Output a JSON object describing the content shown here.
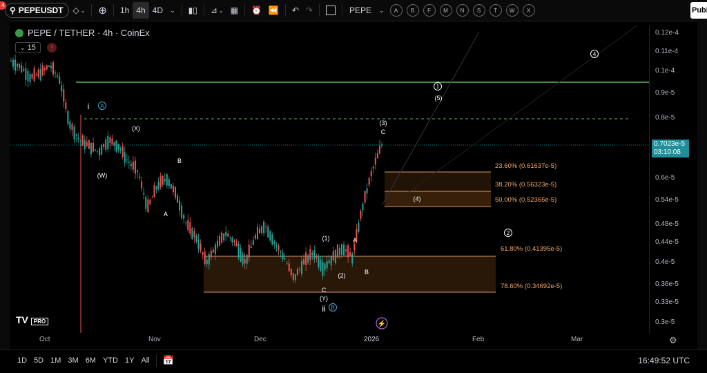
{
  "toolbar": {
    "symbol": "PEPEUSDT",
    "intervals": [
      "1h",
      "4h",
      "4D"
    ],
    "active_interval": "4h",
    "tool_label": "PEPE",
    "pattern_letters": [
      "A",
      "B",
      "F",
      "M",
      "N",
      "S",
      "T",
      "W",
      "X"
    ],
    "publish_label": "Publi",
    "notification_count": "4"
  },
  "legend": {
    "title": "PEPE / TETHER · 4h · CoinEx",
    "interval_count": "15",
    "warning": "!"
  },
  "price_axis": {
    "labels": [
      "0.12e-4",
      "0.11e-4",
      "0.1e-4",
      "0.9e-5",
      "0.8e-5",
      "0.7023e-5",
      "0.6e-5",
      "0.54e-5",
      "0.48e-5",
      "0.44e-5",
      "0.4e-5",
      "0.36e-5",
      "0.33e-5",
      "0.3e-5"
    ],
    "last_price": "0.7023e-5",
    "countdown": "03:10:08"
  },
  "time_axis": {
    "labels": [
      "Oct",
      "Nov",
      "Dec",
      "2026",
      "Feb",
      "Mar"
    ]
  },
  "fib_levels": [
    {
      "label": "23.60% (0.61637e-5)",
      "color": "#f0a46a"
    },
    {
      "label": "38.20% (0.56323e-5)",
      "color": "#f0a46a"
    },
    {
      "label": "50.00% (0.52365e-5)",
      "color": "#f0a46a"
    },
    {
      "label": "61.80% (0.41395e-5)",
      "color": "#f0a46a"
    },
    {
      "label": "78.60% (0.34692e-5)",
      "color": "#f0a46a"
    }
  ],
  "wave_labels": {
    "w_i": "i",
    "w_A_circ": "A",
    "w_X": "(X)",
    "w_W": "(W)",
    "w_B": "B",
    "w_A": "A",
    "w_1": "(1)",
    "w_2": "(2)",
    "w_A2": "A",
    "w_B2": "B",
    "w_C": "C",
    "w_Y": "(Y)",
    "w_ii": "ii",
    "w_B_circ": "B",
    "w_3": "(3)",
    "w_C3": "C",
    "w_4": "(4)",
    "w_5": "(5)",
    "w_circ1": "1",
    "w_circ2": "2",
    "w_circ4": "4"
  },
  "bottom": {
    "ranges": [
      "1D",
      "5D",
      "1M",
      "3M",
      "6M",
      "YTD",
      "1Y",
      "All"
    ],
    "clock": "16:49:52 UTC"
  },
  "logo": {
    "brand": "TV",
    "badge": "PRO"
  },
  "colors": {
    "accent": "#1e8f9a",
    "fib_zone": "#4a2a0e",
    "fib_line": "#e0986a",
    "resistance_line": "#5cb85c",
    "up_candle": "#26a69a",
    "down_candle": "#ef5350"
  },
  "chart_data": {
    "type": "candlestick",
    "title": "PEPE / TETHER · 4h · CoinEx",
    "x": [
      "Oct",
      "Nov",
      "Dec",
      "2026",
      "Feb",
      "Mar"
    ],
    "series": [
      {
        "values": [
          [
            0,
            1.05e-05
          ],
          [
            3,
            1.02e-05
          ],
          [
            6,
            9.7e-06
          ],
          [
            9,
            9.9e-06
          ],
          [
            12,
            1.03e-05
          ],
          [
            15,
            9.6e-06
          ],
          [
            18,
            7.8e-06
          ],
          [
            21,
            7.2e-06
          ],
          [
            24,
            7e-06
          ],
          [
            27,
            6.8e-06
          ],
          [
            30,
            7.2e-06
          ],
          [
            33,
            7e-06
          ],
          [
            36,
            6.5e-06
          ],
          [
            39,
            6.2e-06
          ],
          [
            42,
            5.2e-06
          ],
          [
            45,
            5.8e-06
          ],
          [
            48,
            6e-06
          ],
          [
            51,
            5.5e-06
          ],
          [
            54,
            4.8e-06
          ],
          [
            57,
            4.5e-06
          ],
          [
            60,
            4e-06
          ],
          [
            63,
            4.3e-06
          ],
          [
            66,
            4.6e-06
          ],
          [
            69,
            4.4e-06
          ],
          [
            72,
            4e-06
          ],
          [
            75,
            4.5e-06
          ],
          [
            78,
            4.8e-06
          ],
          [
            81,
            4.4e-06
          ],
          [
            84,
            4.1e-06
          ],
          [
            87,
            3.7e-06
          ],
          [
            90,
            4e-06
          ],
          [
            93,
            4.2e-06
          ],
          [
            96,
            3.9e-06
          ],
          [
            99,
            4.1e-06
          ],
          [
            102,
            4.3e-06
          ],
          [
            105,
            4.1e-06
          ],
          [
            108,
            5.2e-06
          ],
          [
            111,
            6.2e-06
          ],
          [
            114,
            7.023e-06
          ]
        ]
      }
    ],
    "ylim": [
      2.9e-06,
      1.25e-05
    ],
    "log_scale": true
  }
}
